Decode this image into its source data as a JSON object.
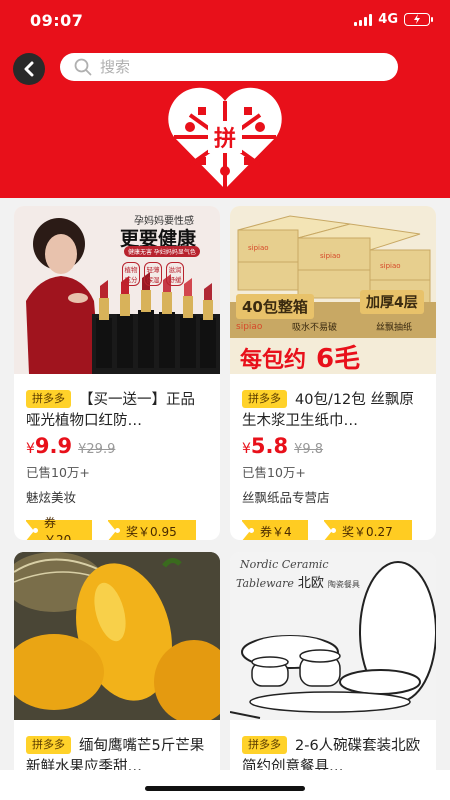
{
  "status_bar": {
    "time": "09:07",
    "network": "4G"
  },
  "search": {
    "placeholder": "搜索"
  },
  "products": [
    {
      "tag": "拼多多",
      "title": "【买一送一】正品哑光植物口红防…",
      "currency": "¥",
      "price": "9.9",
      "original_price": "¥29.9",
      "sold": "已售10万+",
      "shop": "魅炫美妆",
      "coupon": "券￥20",
      "reward": "奖￥0.95",
      "image_text": {
        "line1": "孕妈妈要性感",
        "line2": "更要健康",
        "features": [
          "植物成分",
          "轻薄保湿",
          "滋润舒缓"
        ],
        "sub": "健康无害 孕妇妈妈显气色"
      }
    },
    {
      "tag": "拼多多",
      "title": "40包/12包 丝飘原生木浆卫生纸巾…",
      "currency": "¥",
      "price": "5.8",
      "original_price": "¥9.8",
      "sold": "已售10万+",
      "shop": "丝飘纸品专营店",
      "coupon": "券￥4",
      "reward": "奖￥0.27",
      "image_text": {
        "badge1": "40包整箱",
        "badge2": "加厚4层",
        "brand": "sipiao",
        "small1": "吸水不易破",
        "small2": "丝飘抽纸",
        "banner": "每包约",
        "banner_num": "6毛"
      }
    },
    {
      "tag": "拼多多",
      "title": "缅甸鹰嘴芒5斤芒果新鲜水果应季甜…"
    },
    {
      "tag": "拼多多",
      "title": "2-6人碗碟套装北欧简约创意餐具…",
      "image_text": {
        "script1": "Nordic Ceramic",
        "script2": "Tableware",
        "cn": "北欧",
        "cn_small": "陶瓷餐具"
      }
    }
  ],
  "colors": {
    "brand_red": "#e8101a",
    "tag_yellow": "#ffd22a",
    "coupon_yellow": "#ffcc22"
  }
}
